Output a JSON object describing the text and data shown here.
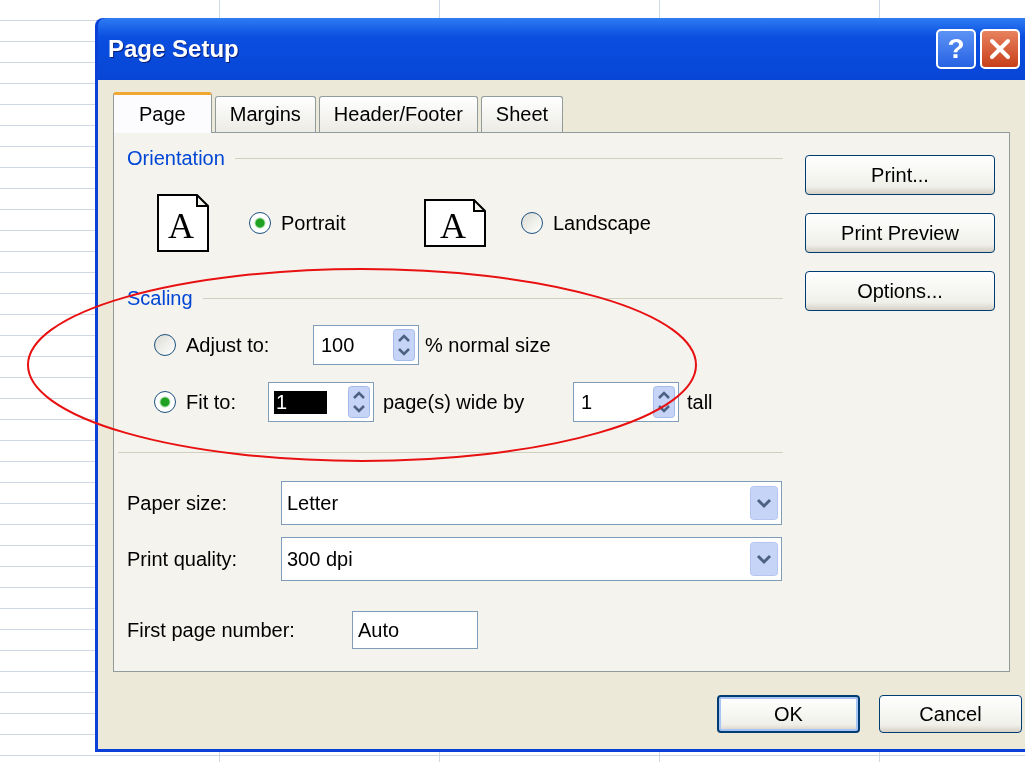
{
  "window": {
    "title": "Page Setup",
    "help_label": "?"
  },
  "tabs": [
    {
      "label": "Page",
      "selected": true
    },
    {
      "label": "Margins",
      "selected": false
    },
    {
      "label": "Header/Footer",
      "selected": false
    },
    {
      "label": "Sheet",
      "selected": false
    }
  ],
  "orientation": {
    "heading": "Orientation",
    "options": [
      {
        "kind": "portrait",
        "icon_letter": "A",
        "label": "Portrait",
        "selected": true
      },
      {
        "kind": "landscape",
        "icon_letter": "A",
        "label": "Landscape",
        "selected": false
      }
    ]
  },
  "scaling": {
    "heading": "Scaling",
    "options": [
      {
        "kind": "adjust",
        "label": "Adjust to:",
        "selected": false,
        "fields": [
          {
            "value": "100",
            "selected": false
          }
        ],
        "texts": [
          "% normal size"
        ]
      },
      {
        "kind": "fit",
        "label": "Fit to:",
        "selected": true,
        "fields": [
          {
            "value": "1",
            "selected": true
          },
          {
            "value": "1",
            "selected": false
          }
        ],
        "texts": [
          "page(s) wide by",
          "tall"
        ]
      }
    ]
  },
  "paper": [
    {
      "kind": "dropdown",
      "label": "Paper size:",
      "value": "Letter"
    },
    {
      "kind": "dropdown",
      "label": "Print quality:",
      "value": "300 dpi"
    },
    {
      "kind": "text",
      "label": "First page number:",
      "value": "Auto"
    }
  ],
  "side_buttons": [
    "Print...",
    "Print Preview",
    "Options..."
  ],
  "buttons": [
    {
      "label": "OK",
      "default": true
    },
    {
      "label": "Cancel",
      "default": false
    }
  ]
}
